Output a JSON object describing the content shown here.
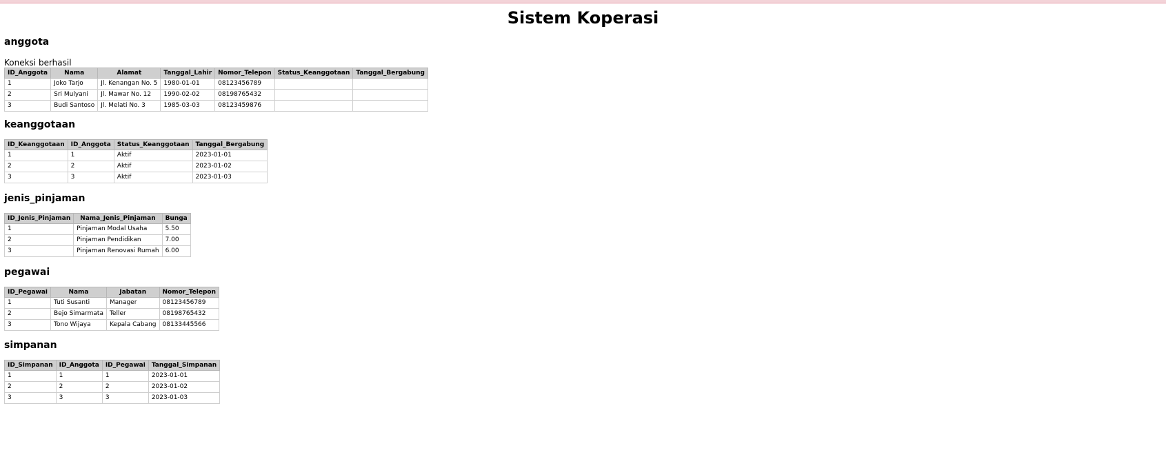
{
  "page_title": "Sistem Koperasi",
  "anggota": {
    "title": "anggota",
    "status": "Koneksi berhasil",
    "columns": [
      "ID_Anggota",
      "Nama",
      "Alamat",
      "Tanggal_Lahir",
      "Nomor_Telepon",
      "Status_Keanggotaan",
      "Tanggal_Bergabung"
    ],
    "rows": [
      [
        "1",
        "Joko Tarjo",
        "Jl. Kenangan No. 5",
        "1980-01-01",
        "08123456789",
        "",
        ""
      ],
      [
        "2",
        "Sri Mulyani",
        "Jl. Mawar No. 12",
        "1990-02-02",
        "08198765432",
        "",
        ""
      ],
      [
        "3",
        "Budi Santoso",
        "Jl. Melati No. 3",
        "1985-03-03",
        "08123459876",
        "",
        ""
      ]
    ]
  },
  "keanggotaan": {
    "title": "keanggotaan",
    "columns": [
      "ID_Keanggotaan",
      "ID_Anggota",
      "Status_Keanggotaan",
      "Tanggal_Bergabung"
    ],
    "rows": [
      [
        "1",
        "1",
        "Aktif",
        "2023-01-01"
      ],
      [
        "2",
        "2",
        "Aktif",
        "2023-01-02"
      ],
      [
        "3",
        "3",
        "Aktif",
        "2023-01-03"
      ]
    ]
  },
  "jenis_pinjaman": {
    "title": "jenis_pinjaman",
    "columns": [
      "ID_Jenis_Pinjaman",
      "Nama_Jenis_Pinjaman",
      "Bunga"
    ],
    "rows": [
      [
        "1",
        "Pinjaman Modal Usaha",
        "5.50"
      ],
      [
        "2",
        "Pinjaman Pendidikan",
        "7.00"
      ],
      [
        "3",
        "Pinjaman Renovasi Rumah",
        "6.00"
      ]
    ]
  },
  "pegawai": {
    "title": "pegawai",
    "columns": [
      "ID_Pegawai",
      "Nama",
      "Jabatan",
      "Nomor_Telepon"
    ],
    "rows": [
      [
        "1",
        "Tuti Susanti",
        "Manager",
        "08123456789"
      ],
      [
        "2",
        "Bejo Simarmata",
        "Teller",
        "08198765432"
      ],
      [
        "3",
        "Tono Wijaya",
        "Kepala Cabang",
        "08133445566"
      ]
    ]
  },
  "simpanan": {
    "title": "simpanan",
    "columns": [
      "ID_Simpanan",
      "ID_Anggota",
      "ID_Pegawai",
      "Tanggal_Simpanan"
    ],
    "rows": [
      [
        "1",
        "1",
        "1",
        "2023-01-01"
      ],
      [
        "2",
        "2",
        "2",
        "2023-01-02"
      ],
      [
        "3",
        "3",
        "3",
        "2023-01-03"
      ]
    ]
  }
}
